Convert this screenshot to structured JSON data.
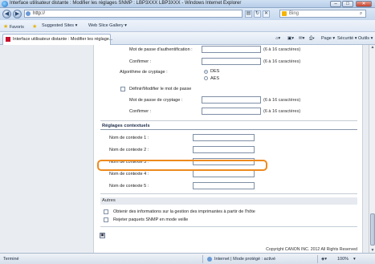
{
  "window": {
    "title": "Interface utilisateur distante : Modifier les réglages SNMP : LBP3XXX LBP3XXX - Windows Internet Explorer",
    "minimize": "–",
    "maximize": "□",
    "close": "✕"
  },
  "address_bar": {
    "back": "◀",
    "forward": "▶",
    "url": "http://",
    "search_placeholder": "Bing",
    "search_icon": "magnifier-icon"
  },
  "favorites_bar": {
    "favorites_label": "Favoris",
    "suggested_sites": "Suggested Sites ▾",
    "web_slice_gallery": "Web Slice Gallery ▾"
  },
  "tab": {
    "label": "Interface utilisateur distante : Modifier les réglage..."
  },
  "command_bar": {
    "page_label": "Page ▾",
    "safety_label": "Sécurité ▾",
    "tools_label": "Outils ▾",
    "help_label": "?"
  },
  "snmpv3": {
    "auth_password_label": "Mot de passe d'authentification :",
    "auth_password_hint": "(6 à 16 caractères)",
    "confirm1_label": "Confirmer :",
    "confirm1_hint": "(6 à 16 caractères)",
    "encryption_label": "Algorithme de cryptage :",
    "encryption_options": [
      "DES",
      "AES"
    ],
    "encryption_selected": "DES",
    "set_change_password_label": "Définir/Modifier le mot de passe",
    "encrypt_password_label": "Mot de passe de cryptage :",
    "encrypt_password_hint": "(6 à 16 caractères)",
    "confirm2_label": "Confirmer :",
    "confirm2_hint": "(6 à 16 caractères)"
  },
  "context_settings": {
    "title": "Réglages contextuels",
    "names": [
      "Nom de contexte 1 :",
      "Nom de contexte 2 :",
      "Nom de contexte 3 :",
      "Nom de contexte 4 :",
      "Nom de contexte 5 :"
    ]
  },
  "others": {
    "title": "Autres",
    "obtain_printer_info_label": "Obtenir des informations sur la gestion des imprimantes à partir de l'hôte",
    "reject_snmp_sleep_label": "Rejeter paquets SNMP en mode veille"
  },
  "footer": {
    "copyright": "Copyright CANON INC. 2012 All Rights Reserved"
  },
  "status_bar": {
    "status": "Terminé",
    "zone": "Internet | Mode protégé : activé",
    "zoom": "100%"
  },
  "colors": {
    "highlight": "#ee8a1d",
    "section_border": "#8897ac"
  }
}
